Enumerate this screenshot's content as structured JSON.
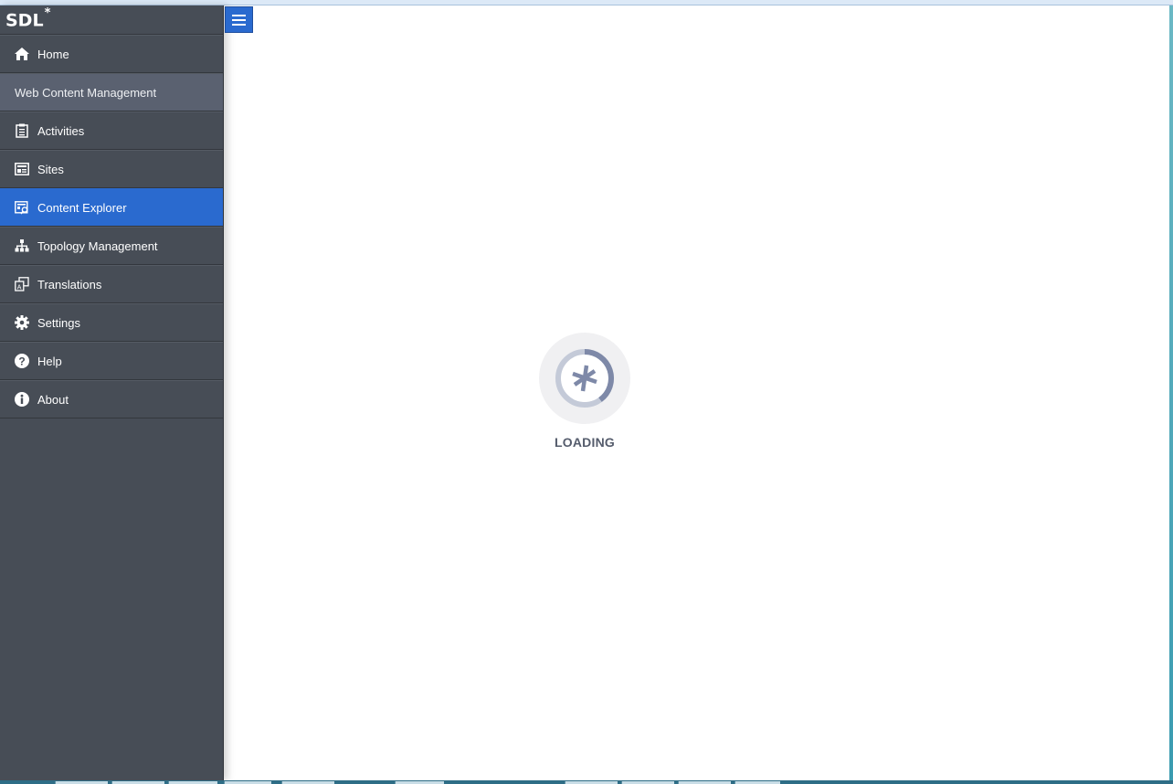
{
  "app": {
    "logo_text": "SDL",
    "logo_mark": "*"
  },
  "toolbar": {
    "menu_toggle_icon": "hamburger-icon"
  },
  "sidebar": {
    "items": [
      {
        "label": "Home",
        "icon": "home-icon"
      },
      {
        "label": "Web Content Management",
        "type": "section"
      },
      {
        "label": "Activities",
        "icon": "clipboard-icon"
      },
      {
        "label": "Sites",
        "icon": "sites-icon"
      },
      {
        "label": "Content Explorer",
        "icon": "content-explorer-icon",
        "active": true
      },
      {
        "label": "Topology Management",
        "icon": "topology-icon"
      },
      {
        "label": "Translations",
        "icon": "translations-icon"
      },
      {
        "label": "Settings",
        "icon": "gear-icon"
      },
      {
        "label": "Help",
        "icon": "help-icon"
      },
      {
        "label": "About",
        "icon": "info-icon"
      }
    ]
  },
  "main": {
    "loading_label": "LOADING"
  },
  "colors": {
    "accent": "#2a6acf",
    "sidebar_bg": "#474d56",
    "section_bg": "#5a6170",
    "loader": "#7e89a8"
  }
}
